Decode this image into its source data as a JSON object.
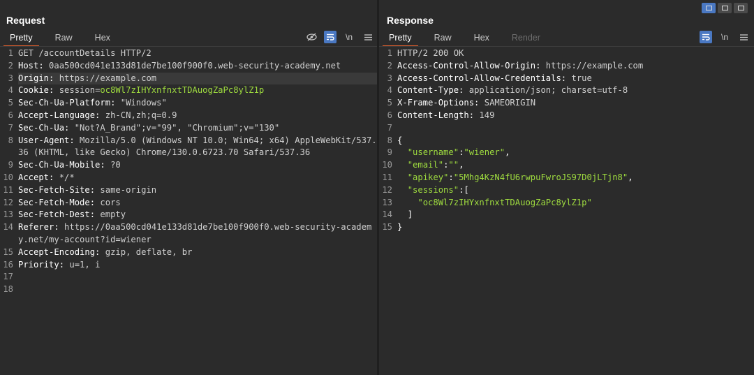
{
  "request": {
    "title": "Request",
    "tabs": [
      "Pretty",
      "Raw",
      "Hex"
    ],
    "newline_label": "\\n",
    "lines": [
      {
        "n": "1",
        "k": "",
        "v": "GET /accountDetails HTTP/2"
      },
      {
        "n": "2",
        "k": "Host:",
        "v": " 0aa500cd041e133d81de7be100f900f0.web-security-academy.net"
      },
      {
        "n": "3",
        "k": "Origin:",
        "v": " https://example.com"
      },
      {
        "n": "4",
        "k": "Cookie:",
        "v": " session=",
        "s": "oc8Wl7zIHYxnfnxtTDAuogZaPc8ylZ1p"
      },
      {
        "n": "5",
        "k": "Sec-Ch-Ua-Platform:",
        "v": " \"Windows\""
      },
      {
        "n": "6",
        "k": "Accept-Language:",
        "v": " zh-CN,zh;q=0.9"
      },
      {
        "n": "7",
        "k": "Sec-Ch-Ua:",
        "v": " \"Not?A_Brand\";v=\"99\", \"Chromium\";v=\"130\""
      },
      {
        "n": "8",
        "k": "User-Agent:",
        "v": " Mozilla/5.0 (Windows NT 10.0; Win64; x64) AppleWebKit/537.36 (KHTML, like Gecko) Chrome/130.0.6723.70 Safari/537.36"
      },
      {
        "n": "9",
        "k": "Sec-Ch-Ua-Mobile:",
        "v": " ?0"
      },
      {
        "n": "10",
        "k": "Accept:",
        "v": " */*"
      },
      {
        "n": "11",
        "k": "Sec-Fetch-Site:",
        "v": " same-origin"
      },
      {
        "n": "12",
        "k": "Sec-Fetch-Mode:",
        "v": " cors"
      },
      {
        "n": "13",
        "k": "Sec-Fetch-Dest:",
        "v": " empty"
      },
      {
        "n": "14",
        "k": "Referer:",
        "v": " https://0aa500cd041e133d81de7be100f900f0.web-security-academy.net/my-account?id=wiener"
      },
      {
        "n": "15",
        "k": "Accept-Encoding:",
        "v": " gzip, deflate, br"
      },
      {
        "n": "16",
        "k": "Priority:",
        "v": " u=1, i"
      },
      {
        "n": "17",
        "k": "",
        "v": ""
      },
      {
        "n": "18",
        "k": "",
        "v": ""
      }
    ]
  },
  "response": {
    "title": "Response",
    "tabs": [
      "Pretty",
      "Raw",
      "Hex",
      "Render"
    ],
    "newline_label": "\\n",
    "lines": [
      {
        "n": "1",
        "k": "",
        "v": "HTTP/2 200 OK"
      },
      {
        "n": "2",
        "k": "Access-Control-Allow-Origin:",
        "v": " https://example.com"
      },
      {
        "n": "3",
        "k": "Access-Control-Allow-Credentials:",
        "v": " true"
      },
      {
        "n": "4",
        "k": "Content-Type:",
        "v": " application/json; charset=utf-8"
      },
      {
        "n": "5",
        "k": "X-Frame-Options:",
        "v": " SAMEORIGIN"
      },
      {
        "n": "6",
        "k": "Content-Length:",
        "v": " 149"
      },
      {
        "n": "7",
        "k": "",
        "v": ""
      },
      {
        "n": "8",
        "k": "",
        "v": "{"
      },
      {
        "n": "9",
        "k": "",
        "v": "  ",
        "s": "\"username\"",
        "v2": ":",
        "s2": "\"wiener\"",
        "v3": ","
      },
      {
        "n": "10",
        "k": "",
        "v": "  ",
        "s": "\"email\"",
        "v2": ":",
        "s2": "\"\"",
        "v3": ","
      },
      {
        "n": "11",
        "k": "",
        "v": "  ",
        "s": "\"apikey\"",
        "v2": ":",
        "s2": "\"5Mhg4KzN4fU6rwpuFwroJS97D0jLTjn8\"",
        "v3": ","
      },
      {
        "n": "12",
        "k": "",
        "v": "  ",
        "s": "\"sessions\"",
        "v2": ":[",
        "s2": "",
        "v3": ""
      },
      {
        "n": "13",
        "k": "",
        "v": "    ",
        "s": "\"oc8Wl7zIHYxnfnxtTDAuogZaPc8ylZ1p\""
      },
      {
        "n": "14",
        "k": "",
        "v": "  ]"
      },
      {
        "n": "15",
        "k": "",
        "v": "}"
      }
    ]
  }
}
